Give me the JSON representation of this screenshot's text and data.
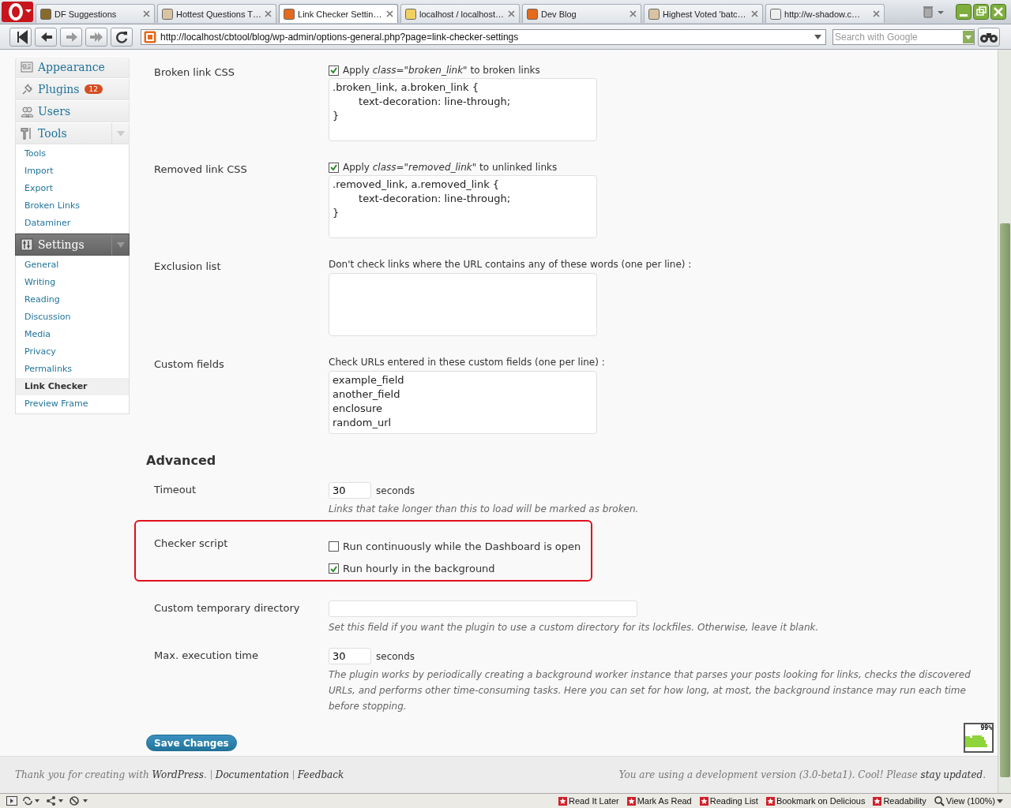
{
  "browser": {
    "tabs": [
      {
        "title": "DF Suggestions",
        "selected": false
      },
      {
        "title": "Hottest Questions T…",
        "selected": false
      },
      {
        "title": "Link Checker Settin…",
        "selected": true
      },
      {
        "title": "localhost / localhost…",
        "selected": false
      },
      {
        "title": "Dev Blog",
        "selected": false
      },
      {
        "title": "Highest Voted 'batc…",
        "selected": false
      },
      {
        "title": "http://w-shadow.c…",
        "selected": false
      }
    ],
    "address": "http://localhost/cbtool/blog/wp-admin/options-general.php?page=link-checker-settings",
    "search": {
      "placeholder": "Search with Google"
    }
  },
  "sidebar": {
    "groups": [
      {
        "label": "Appearance",
        "expanded": false,
        "selected": false
      },
      {
        "label": "Plugins",
        "badge": "12",
        "expanded": false,
        "selected": false
      },
      {
        "label": "Users",
        "expanded": false,
        "selected": false
      },
      {
        "label": "Tools",
        "expanded": true,
        "selected": false,
        "children": [
          {
            "label": "Tools",
            "selected": false
          },
          {
            "label": "Import",
            "selected": false
          },
          {
            "label": "Export",
            "selected": false
          },
          {
            "label": "Broken Links",
            "selected": false
          },
          {
            "label": "Dataminer",
            "selected": false
          }
        ]
      },
      {
        "label": "Settings",
        "expanded": true,
        "selected": true,
        "children": [
          {
            "label": "General",
            "selected": false
          },
          {
            "label": "Writing",
            "selected": false
          },
          {
            "label": "Reading",
            "selected": false
          },
          {
            "label": "Discussion",
            "selected": false
          },
          {
            "label": "Media",
            "selected": false
          },
          {
            "label": "Privacy",
            "selected": false
          },
          {
            "label": "Permalinks",
            "selected": false
          },
          {
            "label": "Link Checker",
            "selected": true
          },
          {
            "label": "Preview Frame",
            "selected": false
          }
        ]
      }
    ]
  },
  "settings": [
    {
      "kind": "css",
      "label": "Broken link CSS",
      "option": {
        "label": "Apply *class=\"broken_link\"* to broken links",
        "checked": true
      },
      "value": ".broken_link, a.broken_link {\n\ttext-decoration: line-through;\n}"
    },
    {
      "kind": "css",
      "label": "Removed link CSS",
      "option": {
        "label": "Apply *class=\"removed_link\"* to unlinked links",
        "checked": true
      },
      "value": ".removed_link, a.removed_link {\n\ttext-decoration: line-through;\n}"
    },
    {
      "kind": "textarea",
      "label": "Exclusion list",
      "hint": "Don't check links where the URL contains any of these words (one per line) :"
    },
    {
      "kind": "textarea",
      "label": "Custom fields",
      "hint": "Check URLs entered in these custom fields (one per line) :",
      "value": "example_field\nanother_field\nenclosure\nrandom_url"
    },
    {
      "kind": "heading",
      "label": "Advanced"
    },
    {
      "kind": "number",
      "label": "Timeout",
      "value": "30",
      "unit": "seconds",
      "note": "Links that take longer than this to load will be marked as broken."
    },
    {
      "kind": "checklist",
      "label": "Checker script",
      "highlighted": true,
      "options": [
        {
          "label": "Run continuously while the Dashboard is open",
          "checked": false
        },
        {
          "label": "Run hourly in the background",
          "checked": true
        }
      ]
    },
    {
      "kind": "text",
      "label": "Custom temporary directory",
      "note": "Set this field if you want the plugin to use a custom directory for its lockfiles. Otherwise, leave it blank."
    },
    {
      "kind": "number",
      "label": "Max. execution time",
      "value": "30",
      "unit": "seconds",
      "note": "The plugin works by periodically creating a background worker instance that parses your posts looking for links, checks the discovered URLs, and performs other time-consuming tasks. Here you can set for how long, at most, the background instance may run each time before stopping."
    }
  ],
  "save_button": "Save Changes",
  "meter": {
    "reading": "99%"
  },
  "footer": {
    "left": {
      "before": "Thank you for creating with ",
      "link": "WordPress",
      "after": "."
    },
    "links": [
      "Documentation",
      "Feedback"
    ],
    "right": {
      "before": "You are using a development version (3.0-beta1). Cool! Please ",
      "link": "stay updated",
      "after": "."
    }
  },
  "status_bar": {
    "items": [
      "Read It Later",
      "Mark As Read",
      "Reading List",
      "Bookmark on Delicious",
      "Readability"
    ],
    "zoom": "View (100%)"
  }
}
